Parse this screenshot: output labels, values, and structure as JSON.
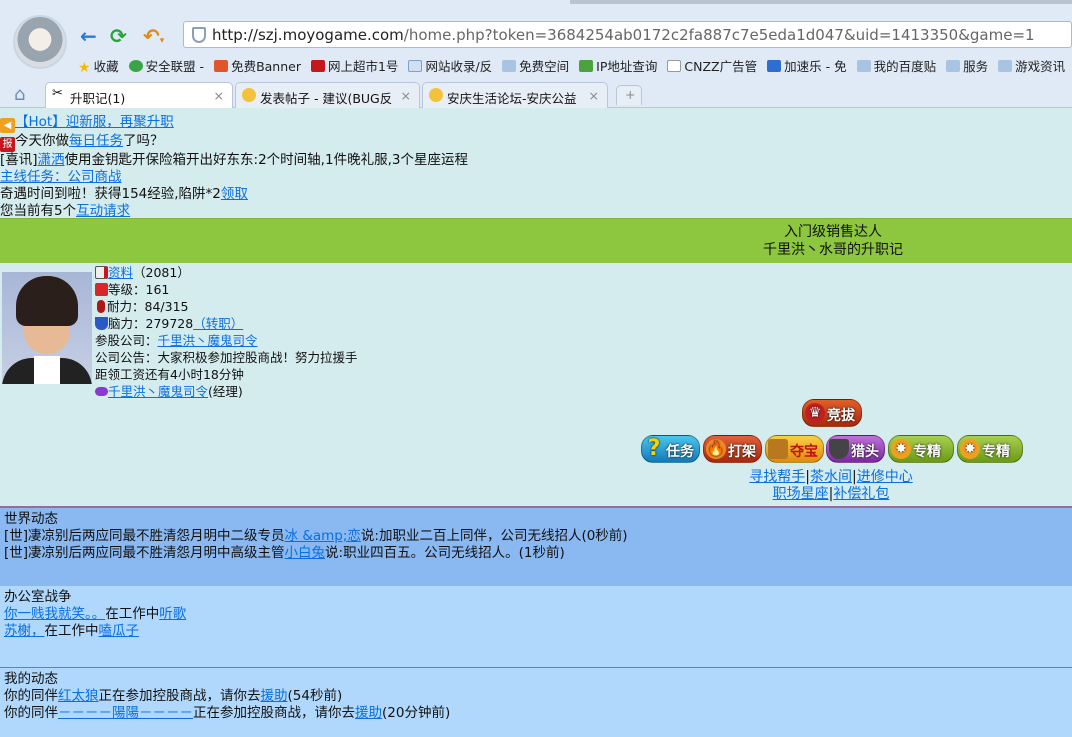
{
  "browser": {
    "url_host": "http://szj.moyogame.com",
    "url_rest": "/home.php?token=3684254ab0172c2fa887c7e5eda1d047&uid=1413350&game=1",
    "bookmarks": [
      "收藏",
      "安全联盟 -",
      "免费Banner",
      "网上超市1号",
      "网站收录/反",
      "免费空间",
      "IP地址查询",
      "CNZZ广告管",
      "加速乐 - 免",
      "我的百度贴",
      "服务",
      "游戏资讯"
    ],
    "tabs": [
      "升职记(1)",
      "发表帖子 - 建议(BUG反",
      "安庆生活论坛-安庆公益"
    ],
    "tab_close": "×",
    "new_tab": "+"
  },
  "notices": {
    "hot_prefix": "【Hot】",
    "hot_link": "迎新服，再聚升职",
    "daily_pre": "今天你做",
    "daily_link": "每日任务",
    "daily_post": "了吗？",
    "news_pre": "[喜讯]",
    "news_user": "潇洒",
    "news_text": "使用金钥匙开保险箱开出好东东:2个时间轴,1件晚礼服,3个星座运程",
    "mainline": "主线任务：公司商战",
    "event_text": "奇遇时间到啦！获得154经验,陷阱*2",
    "event_link": "领取",
    "req_pre": "您当前有5个",
    "req_link": "互动请求"
  },
  "band": {
    "line1": "入门级销售达人",
    "line2": "千里洪丶水哥的升职记"
  },
  "profile": {
    "info_link": "资料",
    "info_count": "（2081）",
    "level": "等级：161",
    "stamina": "耐力：84/315",
    "brain": "脑力：279728",
    "transfer": "（转职）",
    "company_label": "参股公司：",
    "company": "千里洪丶魔鬼司令",
    "notice": "公司公告：大家积极参加控股商战！努力拉援手",
    "salary": "距领工资还有4小时18分钟",
    "manager": "千里洪丶魔鬼司令",
    "manager_role": "(经理)"
  },
  "actions": {
    "compete": "竞拔",
    "buttons": [
      "任务",
      "打架",
      "夺宝",
      "猎头",
      "专精",
      "专精"
    ],
    "links1": [
      "寻找帮手",
      "茶水间",
      "进修中心"
    ],
    "links2": [
      "职场星座",
      "补偿礼包"
    ],
    "sep": "|"
  },
  "world": {
    "title": "世界动态",
    "items": [
      {
        "pre": "[世]凄凉别后两应同最不胜清怨月明中二级专员",
        "user": "冰 &amp;恋",
        "post": "说:加职业二百上同伴，公司无线招人(0秒前)"
      },
      {
        "pre": "[世]凄凉别后两应同最不胜清怨月明中高级主管",
        "user": "小白兔",
        "post": "说:职业四百五。公司无线招人。(1秒前)"
      }
    ]
  },
  "office": {
    "title": "办公室战争",
    "items": [
      {
        "user": "你一贱我就笑。。",
        "mid": "在工作中",
        "act": "听歌"
      },
      {
        "user": "苏榭，",
        "mid": "在工作中",
        "act": "嗑瓜子"
      }
    ]
  },
  "mine": {
    "title": "我的动态",
    "items": [
      {
        "pre": "你的同伴",
        "user": "红太狼",
        "mid": "正在参加控股商战，请你去",
        "link": "援助",
        "post": "(54秒前)"
      },
      {
        "pre": "你的同伴",
        "user": "－－－－陽陽－－－－",
        "mid": "正在参加控股商战，请你去",
        "link": "援助",
        "post": "(20分钟前)"
      }
    ]
  },
  "colors": {
    "band": "#8dc63f",
    "page": "#d5ecee",
    "world": "#8ab8f0",
    "office": "#b0d8fc",
    "link": "#0a6fe0"
  }
}
